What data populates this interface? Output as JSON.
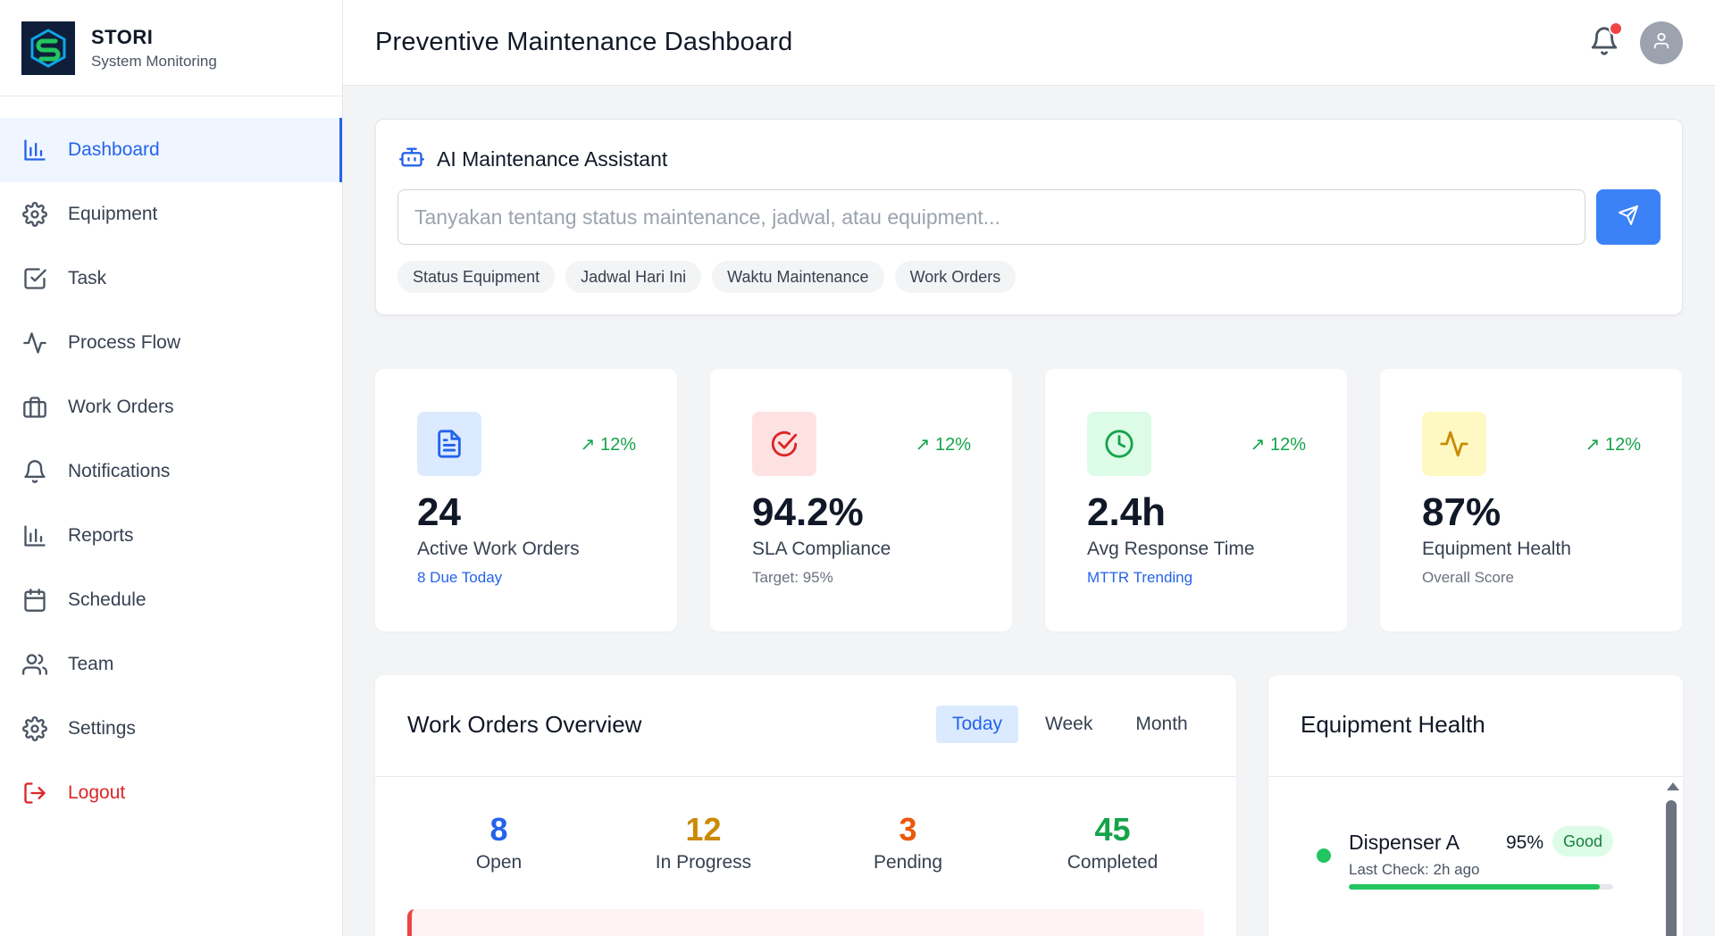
{
  "brand": {
    "name": "STORI",
    "subtitle": "System Monitoring"
  },
  "sidebar": {
    "items": [
      {
        "label": "Dashboard",
        "icon": "bar-chart-icon",
        "active": true
      },
      {
        "label": "Equipment",
        "icon": "gear-icon"
      },
      {
        "label": "Task",
        "icon": "checkbox-icon"
      },
      {
        "label": "Process Flow",
        "icon": "activity-icon"
      },
      {
        "label": "Work Orders",
        "icon": "briefcase-icon"
      },
      {
        "label": "Notifications",
        "icon": "bell-icon"
      },
      {
        "label": "Reports",
        "icon": "bar-chart-icon"
      },
      {
        "label": "Schedule",
        "icon": "calendar-icon"
      },
      {
        "label": "Team",
        "icon": "users-icon"
      },
      {
        "label": "Settings",
        "icon": "gear-icon"
      },
      {
        "label": "Logout",
        "icon": "logout-icon"
      }
    ]
  },
  "header": {
    "title": "Preventive Maintenance Dashboard"
  },
  "assistant": {
    "title": "AI Maintenance Assistant",
    "placeholder": "Tanyakan tentang status maintenance, jadwal, atau equipment...",
    "value": "",
    "chips": [
      "Status Equipment",
      "Jadwal Hari Ini",
      "Waktu Maintenance",
      "Work Orders"
    ]
  },
  "stats": [
    {
      "icon": "document-icon",
      "trend": "↗ 12%",
      "value": "24",
      "label": "Active Work Orders",
      "sub": "8 Due Today",
      "color": "#2563eb",
      "bg": "#dbeafe",
      "sub_blue": true
    },
    {
      "icon": "target-check-icon",
      "trend": "↗ 12%",
      "value": "94.2%",
      "label": "SLA Compliance",
      "sub": "Target: 95%",
      "color": "#dc2626",
      "bg": "#fee2e2",
      "sub_blue": false
    },
    {
      "icon": "clock-icon",
      "trend": "↗ 12%",
      "value": "2.4h",
      "label": "Avg Response Time",
      "sub": "MTTR Trending",
      "color": "#16a34a",
      "bg": "#dcfce7",
      "sub_blue": true
    },
    {
      "icon": "pulse-icon",
      "trend": "↗ 12%",
      "value": "87%",
      "label": "Equipment Health",
      "sub": "Overall Score",
      "color": "#ca8a04",
      "bg": "#fef9c3",
      "sub_blue": false
    }
  ],
  "work_orders": {
    "title": "Work Orders Overview",
    "tabs": [
      "Today",
      "Week",
      "Month"
    ],
    "active_tab": "Today",
    "summary": [
      {
        "value": "8",
        "label": "Open",
        "color": "#2563eb"
      },
      {
        "value": "12",
        "label": "In Progress",
        "color": "#ca8a04"
      },
      {
        "value": "3",
        "label": "Pending",
        "color": "#ea580c"
      },
      {
        "value": "45",
        "label": "Completed",
        "color": "#16a34a"
      }
    ]
  },
  "equipment_health": {
    "title": "Equipment Health",
    "items": [
      {
        "name": "Dispenser A",
        "percent": "95%",
        "status": "Good",
        "last_check": "Last Check: 2h ago",
        "level": 0.95
      }
    ]
  }
}
